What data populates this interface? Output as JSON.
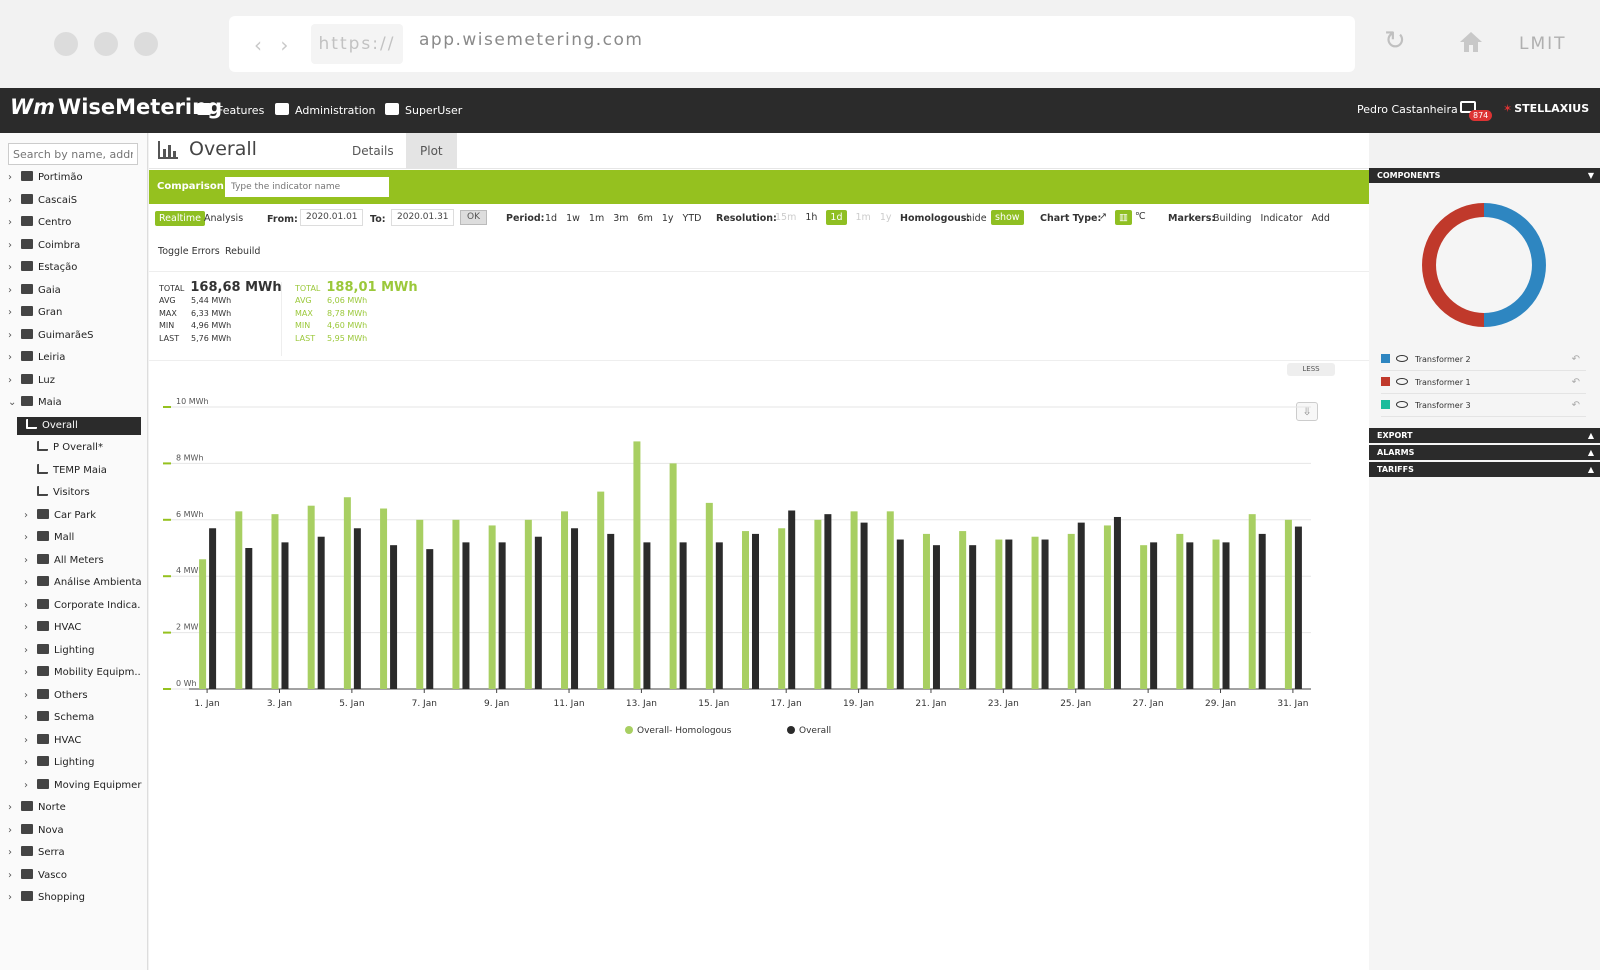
{
  "browser": {
    "scheme": "https://",
    "host": "app.wisemetering.com",
    "right_label": "LMIT",
    "nav_arrows": "‹ ›"
  },
  "header": {
    "logo": "WiseMetering",
    "nav": [
      "Features",
      "Administration",
      "SuperUser"
    ],
    "user": "Pedro Castanheira",
    "mail_count": "874",
    "brand": "STELLAXIUS"
  },
  "sidebar": {
    "search_placeholder": "Search by name, address",
    "tree": [
      {
        "label": "Portimão",
        "level": 0,
        "expanded": false,
        "icon": "building-icon"
      },
      {
        "label": "CascaiS",
        "level": 0,
        "expanded": false,
        "icon": "building-icon"
      },
      {
        "label": "Centro",
        "level": 0,
        "expanded": false,
        "icon": "building-icon"
      },
      {
        "label": "Coimbra",
        "level": 0,
        "expanded": false,
        "icon": "building-icon"
      },
      {
        "label": "Estação",
        "level": 0,
        "expanded": false,
        "icon": "building-icon"
      },
      {
        "label": "Gaia",
        "level": 0,
        "expanded": false,
        "icon": "building-icon"
      },
      {
        "label": "Gran",
        "level": 0,
        "expanded": false,
        "icon": "building-icon"
      },
      {
        "label": "GuimarãeS",
        "level": 0,
        "expanded": false,
        "icon": "building-icon"
      },
      {
        "label": "Leiria",
        "level": 0,
        "expanded": false,
        "icon": "building-icon"
      },
      {
        "label": "Luz",
        "level": 0,
        "expanded": false,
        "icon": "building-icon"
      },
      {
        "label": "Maia",
        "level": 0,
        "expanded": true,
        "icon": "building-icon"
      },
      {
        "label": "Overall",
        "level": 1,
        "leaf": true,
        "selected": true,
        "icon": "chart-icon"
      },
      {
        "label": "P Overall*",
        "level": 1,
        "leaf": true,
        "icon": "chart-icon"
      },
      {
        "label": "TEMP Maia",
        "level": 1,
        "leaf": true,
        "icon": "chart-icon"
      },
      {
        "label": "Visitors",
        "level": 1,
        "leaf": true,
        "icon": "chart-icon"
      },
      {
        "label": "Car Park",
        "level": 1,
        "expanded": false,
        "icon": "layers-icon"
      },
      {
        "label": "Mall",
        "level": 1,
        "expanded": false,
        "icon": "layers-icon"
      },
      {
        "label": "All Meters",
        "level": 1,
        "expanded": false,
        "icon": "folder-icon"
      },
      {
        "label": "Análise Ambienta",
        "level": 1,
        "expanded": false,
        "icon": "folder-icon"
      },
      {
        "label": "Corporate Indica.",
        "level": 1,
        "expanded": false,
        "icon": "folder-icon"
      },
      {
        "label": "HVAC",
        "level": 1,
        "expanded": false,
        "icon": "folder-icon"
      },
      {
        "label": "Lighting",
        "level": 1,
        "expanded": false,
        "icon": "folder-icon"
      },
      {
        "label": "Mobility Equipm..",
        "level": 1,
        "expanded": false,
        "icon": "folder-icon"
      },
      {
        "label": "Others",
        "level": 1,
        "expanded": false,
        "icon": "folder-icon"
      },
      {
        "label": "Schema",
        "level": 1,
        "expanded": false,
        "icon": "folder-icon"
      },
      {
        "label": "HVAC",
        "level": 1,
        "expanded": false,
        "icon": "fan-icon"
      },
      {
        "label": "Lighting",
        "level": 1,
        "expanded": false,
        "icon": "bulb-icon"
      },
      {
        "label": "Moving Equipmer",
        "level": 1,
        "expanded": false,
        "icon": "network-icon"
      },
      {
        "label": "Norte",
        "level": 0,
        "expanded": false,
        "icon": "building-icon"
      },
      {
        "label": "Nova",
        "level": 0,
        "expanded": false,
        "icon": "building-icon"
      },
      {
        "label": "Serra",
        "level": 0,
        "expanded": false,
        "icon": "building-icon"
      },
      {
        "label": "Vasco",
        "level": 0,
        "expanded": false,
        "icon": "building-icon"
      },
      {
        "label": "Shopping",
        "level": 0,
        "expanded": false,
        "icon": "building-icon"
      }
    ]
  },
  "page": {
    "title": "Overall",
    "tabs": [
      {
        "label": "Details",
        "active": false
      },
      {
        "label": "Plot",
        "active": true
      }
    ],
    "comparison": {
      "label": "Comparison:",
      "placeholder": "Type the indicator name"
    }
  },
  "toolbar": {
    "mode_active": "Realtime",
    "mode_other": "Analysis",
    "from_label": "From:",
    "from_value": "2020.01.01",
    "to_label": "To:",
    "to_value": "2020.01.31",
    "ok": "OK",
    "period_label": "Period:",
    "periods": [
      "1d",
      "1w",
      "1m",
      "3m",
      "6m",
      "1y",
      "YTD"
    ],
    "resolution_label": "Resolution:",
    "resolutions": [
      {
        "v": "15m",
        "state": "disabled"
      },
      {
        "v": "1h",
        "state": "normal"
      },
      {
        "v": "1d",
        "state": "active"
      },
      {
        "v": "1m",
        "state": "disabled"
      },
      {
        "v": "1y",
        "state": "disabled"
      }
    ],
    "homologous_label": "Homologous:",
    "homologous_hide": "hide",
    "homologous_show": "show",
    "chart_type_label": "Chart Type:",
    "markers_label": "Markers:",
    "markers": [
      "Building",
      "Indicator",
      "Add"
    ],
    "toggle_errors": "Toggle Errors",
    "rebuild": "Rebuild"
  },
  "stats": {
    "current": {
      "total_label": "TOTAL",
      "total": "168,68 MWh",
      "rows": [
        [
          "AVG",
          "5,44 MWh"
        ],
        [
          "MAX",
          "6,33 MWh"
        ],
        [
          "MIN",
          "4,96 MWh"
        ],
        [
          "LAST",
          "5,76 MWh"
        ]
      ]
    },
    "homologous": {
      "total_label": "TOTAL",
      "total": "188,01 MWh",
      "rows": [
        [
          "AVG",
          "6,06 MWh"
        ],
        [
          "MAX",
          "8,78 MWh"
        ],
        [
          "MIN",
          "4,60 MWh"
        ],
        [
          "LAST",
          "5,95 MWh"
        ]
      ]
    }
  },
  "less_label": "LESS",
  "chart_data": {
    "type": "bar",
    "ylim": [
      0,
      10
    ],
    "yticks": [
      "0 Wh",
      "2 MWh",
      "4 MWh",
      "6 MWh",
      "8 MWh",
      "10 MWh"
    ],
    "xtick_labels": [
      "1. Jan",
      "3. Jan",
      "5. Jan",
      "7. Jan",
      "9. Jan",
      "11. Jan",
      "13. Jan",
      "15. Jan",
      "17. Jan",
      "19. Jan",
      "21. Jan",
      "23. Jan",
      "25. Jan",
      "27. Jan",
      "29. Jan",
      "31. Jan"
    ],
    "categories": [
      "1",
      "2",
      "3",
      "4",
      "5",
      "6",
      "7",
      "8",
      "9",
      "10",
      "11",
      "12",
      "13",
      "14",
      "15",
      "16",
      "17",
      "18",
      "19",
      "20",
      "21",
      "22",
      "23",
      "24",
      "25",
      "26",
      "27",
      "28",
      "29",
      "30",
      "31"
    ],
    "series": [
      {
        "name": "Overall- Homologous",
        "color": "#a8cf62",
        "values": [
          4.6,
          6.3,
          6.2,
          6.5,
          6.8,
          6.4,
          6.0,
          6.0,
          5.8,
          6.0,
          6.3,
          7.0,
          8.78,
          8.0,
          6.6,
          5.6,
          5.7,
          6.0,
          6.3,
          6.3,
          5.5,
          5.6,
          5.3,
          5.4,
          5.5,
          5.8,
          5.1,
          5.5,
          5.3,
          6.2,
          6.0
        ]
      },
      {
        "name": "Overall",
        "color": "#2b2b2b",
        "values": [
          5.7,
          5.0,
          5.2,
          5.4,
          5.7,
          5.1,
          4.96,
          5.2,
          5.2,
          5.4,
          5.7,
          5.5,
          5.2,
          5.2,
          5.2,
          5.5,
          6.33,
          6.2,
          5.9,
          5.3,
          5.1,
          5.1,
          5.3,
          5.3,
          5.9,
          6.1,
          5.2,
          5.2,
          5.2,
          5.5,
          5.76
        ]
      }
    ]
  },
  "components": {
    "title": "COMPONENTS",
    "donut": [
      {
        "name": "Transformer 2",
        "color": "#2e86c1",
        "share": 0.5
      },
      {
        "name": "Transformer 1",
        "color": "#c0392b",
        "share": 0.5
      }
    ],
    "legend": [
      {
        "name": "Transformer 2",
        "color": "#2e86c1"
      },
      {
        "name": "Transformer 1",
        "color": "#c0392b"
      },
      {
        "name": "Transformer 3",
        "color": "#1abc9c"
      }
    ]
  },
  "panels": [
    "EXPORT",
    "ALARMS",
    "TARIFFS"
  ]
}
